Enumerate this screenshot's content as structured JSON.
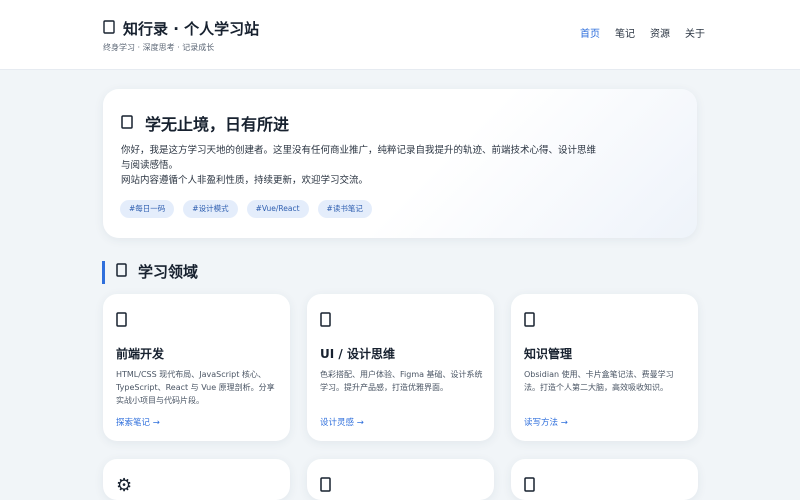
{
  "header": {
    "logo_icon": "book-icon",
    "title": "知行录 · 个人学习站",
    "subtitle": "终身学习 · 深度思考 · 记录成长",
    "nav": [
      {
        "label": "首页",
        "active": true
      },
      {
        "label": "笔记",
        "active": false
      },
      {
        "label": "资源",
        "active": false
      },
      {
        "label": "关于",
        "active": false
      }
    ]
  },
  "hero": {
    "icon": "sparkle-icon",
    "title": "学无止境，日有所进",
    "paragraph1": "你好，我是这方学习天地的创建者。这里没有任何商业推广，纯粹记录自我提升的轨迹、前端技术心得、设计思维与阅读感悟。",
    "paragraph2": "网站内容遵循个人非盈利性质，持续更新，欢迎学习交流。",
    "tags": [
      "#每日一码",
      "#设计模式",
      "#Vue/React",
      "#读书笔记"
    ]
  },
  "section": {
    "icon": "books-icon",
    "title": "学习领域"
  },
  "cards": [
    {
      "icon": "laptop-icon",
      "title": "前端开发",
      "desc": "HTML/CSS 现代布局、JavaScript 核心、TypeScript、React 与 Vue 原理剖析。分享实战小项目与代码片段。",
      "link": "探索笔记 →"
    },
    {
      "icon": "palette-icon",
      "title": "UI / 设计思维",
      "desc": "色彩搭配、用户体验、Figma 基础、设计系统学习。提升产品感，打造优雅界面。",
      "link": "设计灵感 →"
    },
    {
      "icon": "notebook-icon",
      "title": "知识管理",
      "desc": "Obsidian 使用、卡片盒笔记法、费曼学习法。打造个人第二大脑，高效吸收知识。",
      "link": "读写方法 →"
    },
    {
      "icon": "gear-icon"
    },
    {
      "icon": "bar-chart-icon"
    },
    {
      "icon": "leaf-icon"
    }
  ]
}
